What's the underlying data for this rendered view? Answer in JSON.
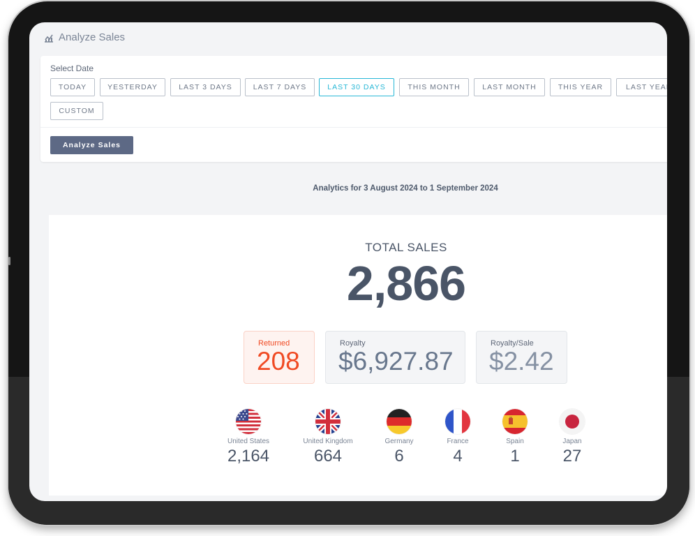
{
  "header": {
    "title": "Analyze Sales",
    "icon": "chart-icon"
  },
  "date_filter": {
    "label": "Select Date",
    "options": [
      "Today",
      "Yesterday",
      "Last 3 Days",
      "Last 7 Days",
      "Last 30 Days",
      "This Month",
      "Last Month",
      "This Year",
      "Last Year",
      "Custom"
    ],
    "selected": "Last 30 Days",
    "analyze_label": "Analyze Sales"
  },
  "range_text": "Analytics for 3 August 2024 to 1 September 2024",
  "totals": {
    "label": "TOTAL SALES",
    "value": "2,866"
  },
  "stats": {
    "returned": {
      "label": "Returned",
      "value": "208"
    },
    "royalty": {
      "label": "Royalty",
      "value": "$6,927.87"
    },
    "royalty_per_sale": {
      "label": "Royalty/Sale",
      "value": "$2.42"
    }
  },
  "countries": [
    {
      "name": "United States",
      "value": "2,164",
      "icon": "us-flag-icon"
    },
    {
      "name": "United Kingdom",
      "value": "664",
      "icon": "uk-flag-icon"
    },
    {
      "name": "Germany",
      "value": "6",
      "icon": "germany-flag-icon"
    },
    {
      "name": "France",
      "value": "4",
      "icon": "france-flag-icon"
    },
    {
      "name": "Spain",
      "value": "1",
      "icon": "spain-flag-icon"
    },
    {
      "name": "Japan",
      "value": "27",
      "icon": "japan-flag-icon"
    }
  ],
  "colors": {
    "accent": "#27b7d6",
    "primary_button": "#5d6985",
    "returned": "#f04a23",
    "text": "#4a5567"
  }
}
